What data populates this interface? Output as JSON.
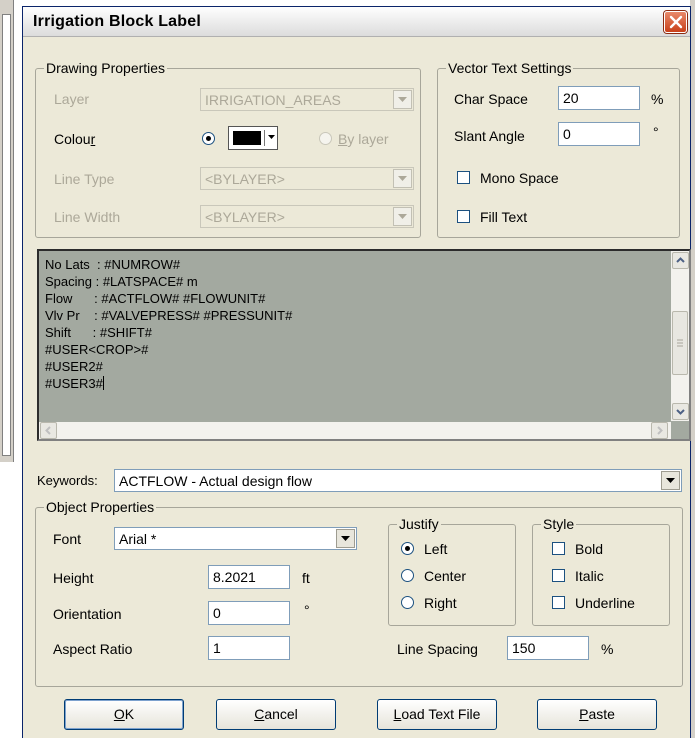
{
  "window": {
    "title": "Irrigation Block Label"
  },
  "drawing_properties": {
    "title": "Drawing Properties",
    "layer_label": "Layer",
    "layer_value": "IRRIGATION_AREAS",
    "colour_label_main": "Colou",
    "colour_label_u": "r",
    "by_layer_u": "B",
    "by_layer_rest": "y layer",
    "line_type_label": "Line Type",
    "line_type_value": "<BYLAYER>",
    "line_width_label": "Line Width",
    "line_width_value": "<BYLAYER>",
    "colour_swatch": "#000000"
  },
  "vector_text": {
    "title": "Vector Text Settings",
    "char_space_label": "Char Space",
    "char_space_value": "20",
    "char_space_unit": "%",
    "slant_label": "Slant Angle",
    "slant_value": "0",
    "slant_unit": "°",
    "mono_label": "Mono Space",
    "fill_label": "Fill Text"
  },
  "editor": {
    "lines": [
      "No Lats  : #NUMROW#",
      "Spacing : #LATSPACE# m",
      "Flow      : #ACTFLOW# #FLOWUNIT#",
      "Vlv Pr    : #VALVEPRESS# #PRESSUNIT#",
      "Shift      : #SHIFT#",
      "#USER<CROP>#",
      "#USER2#",
      "#USER3#"
    ]
  },
  "keywords": {
    "label": "Keywords:",
    "value": "ACTFLOW  -  Actual design flow"
  },
  "object_properties": {
    "title": "Object Properties",
    "font_label": "Font",
    "font_value": "Arial *",
    "height_label": "Height",
    "height_value": "8.2021",
    "height_unit": "ft",
    "orientation_label": "Orientation",
    "orientation_value": "0",
    "orientation_unit": "°",
    "aspect_label": "Aspect Ratio",
    "aspect_value": "1",
    "line_spacing_label": "Line Spacing",
    "line_spacing_value": "150",
    "line_spacing_unit": "%"
  },
  "justify": {
    "title": "Justify",
    "left": "Left",
    "center": "Center",
    "right": "Right",
    "selected": "Left"
  },
  "style": {
    "title": "Style",
    "bold": "Bold",
    "italic": "Italic",
    "underline": "Underline"
  },
  "buttons": {
    "ok_u": "O",
    "ok_rest": "K",
    "cancel_u": "C",
    "cancel_rest": "ancel",
    "load_u": "L",
    "load_rest": "oad Text File",
    "paste_u": "P",
    "paste_rest": "aste"
  },
  "colors": {
    "title_bar_start": "#fefefe",
    "close": "#c9401a",
    "editor_bg": "#a3a9a0",
    "dialog_bg": "#ece9d8"
  }
}
